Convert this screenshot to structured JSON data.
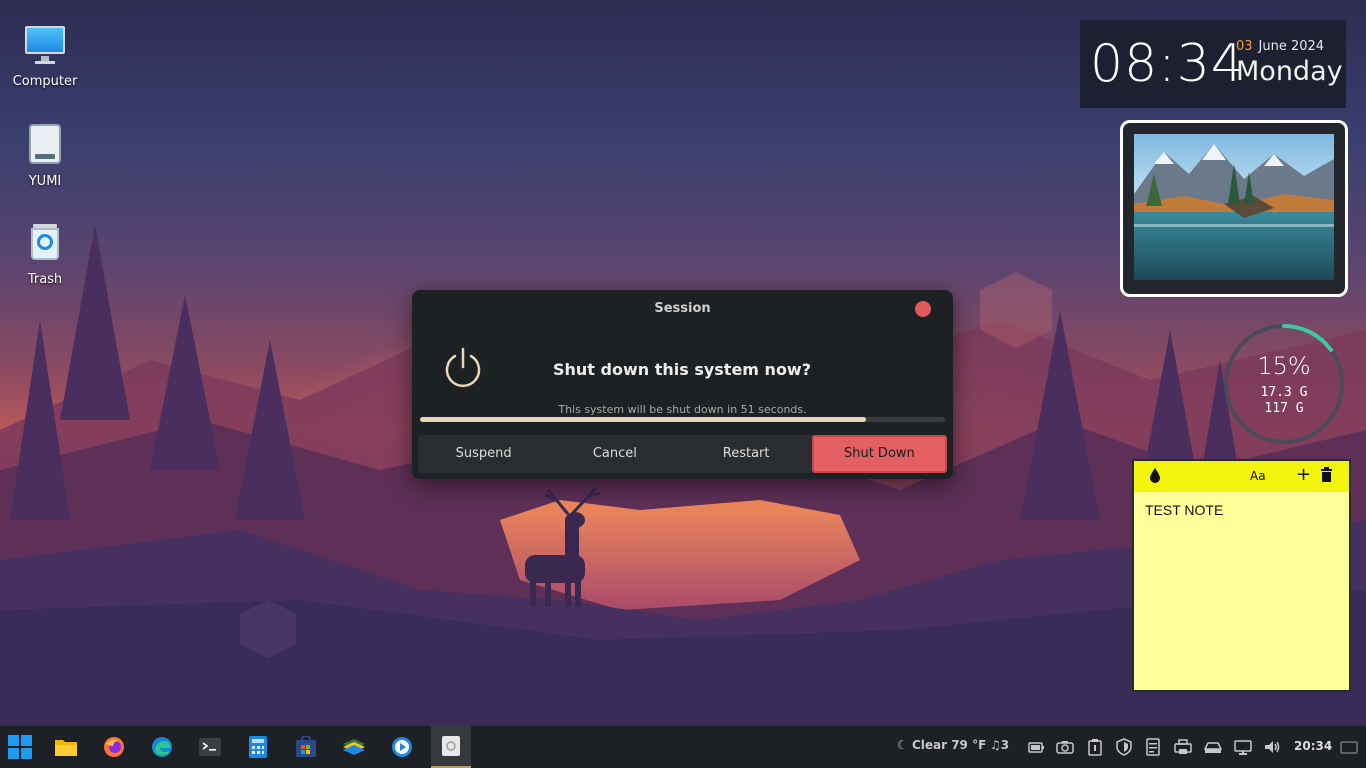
{
  "desktop": {
    "icons": [
      {
        "label": "Computer",
        "icon": "monitor-icon"
      },
      {
        "label": "YUMI",
        "icon": "drive-icon"
      },
      {
        "label": "Trash",
        "icon": "trash-icon"
      }
    ]
  },
  "clock_widget": {
    "time": "08:34",
    "day": "03",
    "month_year": "June 2024",
    "weekday": "Monday"
  },
  "disk_widget": {
    "percent_label": "15%",
    "percent": 15,
    "used": "17.3 G",
    "total": "117 G"
  },
  "sticky_note": {
    "text": "TEST NOTE",
    "toolbar": [
      "drop-icon",
      "font-icon",
      "add-icon",
      "delete-icon"
    ]
  },
  "session_dialog": {
    "title": "Session",
    "question": "Shut down this system now?",
    "countdown_text": "This system will be shut down in 51 seconds.",
    "progress_fraction": 0.85,
    "buttons": {
      "suspend": "Suspend",
      "cancel": "Cancel",
      "restart": "Restart",
      "shutdown": "Shut Down"
    }
  },
  "taskbar": {
    "apps": [
      "start-menu-icon",
      "file-manager-icon",
      "firefox-icon",
      "edge-icon",
      "terminal-icon",
      "calculator-icon",
      "software-store-icon",
      "layers-app-icon",
      "media-player-icon",
      "session-app-icon"
    ],
    "weather": "Clear 79 °F",
    "notification_count": "3",
    "clock": "20:34"
  },
  "colors": {
    "accent_shutdown": "#e26062",
    "clock_day": "#f0a040",
    "note_bar": "#f3f50f",
    "note_body": "#ffff99",
    "disk_ring": "#3fc8a0"
  }
}
